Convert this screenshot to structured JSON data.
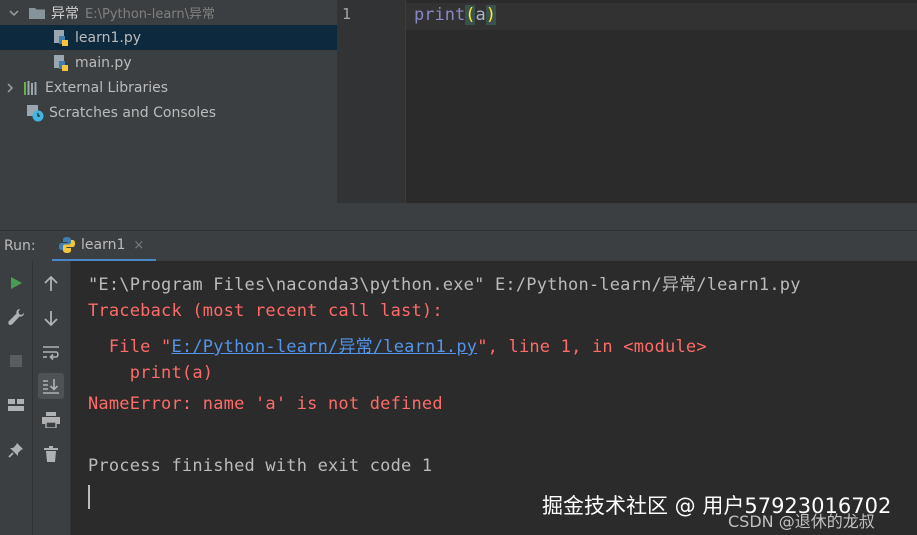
{
  "project_tree": {
    "items": [
      {
        "label": "异常",
        "path": "E:\\Python-learn\\异常",
        "type": "folder"
      },
      {
        "label": "learn1.py",
        "type": "python-file",
        "selected": true
      },
      {
        "label": "main.py",
        "type": "python-file"
      },
      {
        "label": "External Libraries",
        "type": "libraries"
      },
      {
        "label": "Scratches and Consoles",
        "type": "scratches"
      }
    ]
  },
  "editor": {
    "line_number": "1",
    "code": {
      "func": "print",
      "open": "(",
      "arg": "a",
      "close": ")"
    }
  },
  "run_panel": {
    "label": "Run:",
    "tab_label": "learn1",
    "close_glyph": "×"
  },
  "console": {
    "command": "\"E:\\Program Files\\naconda3\\python.exe\" E:/Python-learn/异常/learn1.py",
    "traceback_header": "Traceback (most recent call last):",
    "file_prefix": "  File \"",
    "file_link": "E:/Python-learn/异常/learn1.py",
    "file_suffix": "\", line 1, in <module>",
    "code_line": "    print(a)",
    "error": "NameError: name 'a' is not defined",
    "exit_message": "Process finished with exit code 1"
  },
  "watermark": {
    "primary": "掘金技术社区 @ 用户57923016702",
    "secondary": "CSDN @退休的龙叔"
  },
  "colors": {
    "error": "#ff6b68",
    "link": "#5394ec",
    "selection": "#0d293e",
    "run_icon": "#499c54",
    "tab_underline": "#4a88c7"
  }
}
